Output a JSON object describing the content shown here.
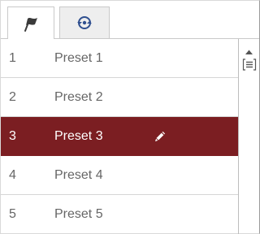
{
  "tabs": [
    {
      "icon": "flag-icon",
      "active": true
    },
    {
      "icon": "patrol-cycle-icon",
      "active": false
    }
  ],
  "presets": [
    {
      "number": "1",
      "name": "Preset 1",
      "selected": false
    },
    {
      "number": "2",
      "name": "Preset 2",
      "selected": false
    },
    {
      "number": "3",
      "name": "Preset 3",
      "selected": true,
      "action_icon": "pencil-icon"
    },
    {
      "number": "4",
      "name": "Preset 4",
      "selected": false
    },
    {
      "number": "5",
      "name": "Preset 5",
      "selected": false
    }
  ],
  "side_controls": {
    "up_icon": "scroll-up-icon",
    "list_icon": "list-icon"
  },
  "colors": {
    "selected_row": "#7b1e22",
    "text": "#666666",
    "border": "#d6d6d6"
  }
}
